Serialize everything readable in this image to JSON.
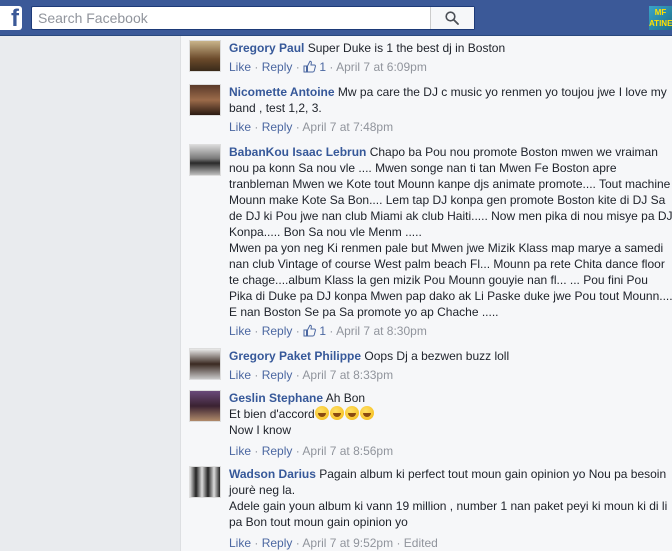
{
  "search": {
    "placeholder": "Search Facebook"
  },
  "profile_badge": "MF ATINE",
  "comments": [
    {
      "author": "Gregory Paul",
      "text": "Super Duke is 1 the best dj in Boston",
      "like": "Like",
      "reply": "Reply",
      "likes": "1",
      "time": "April 7 at 6:09pm"
    },
    {
      "author": "Nicomette Antoine",
      "text": "Mw pa care the DJ c music yo renmen yo toujou jwe I love my band , test 1,2, 3.",
      "like": "Like",
      "reply": "Reply",
      "time": "April 7 at 7:48pm"
    },
    {
      "author": "BabanKou Isaac Lebrun",
      "text": "Chapo ba Pou nou promote Boston mwen we vraiman nou pa konn Sa nou vle .... Mwen songe nan ti tan Mwen Fe Boston apre tranbleman Mwen we Kote tout Mounn kanpe djs animate promote.... Tout machine Mounn make Kote Sa Bon.... Lem tap DJ konpa gen promote Boston kite di DJ Sa de DJ ki Pou jwe nan club Miami ak club Haiti..... Now men pika di nou misye pa DJ Konpa..... Bon Sa nou vle Menm .....",
      "text2": "Mwen pa yon neg Ki renmen pale but Mwen jwe Mizik Klass map marye a samedi nan club Vintage of course West palm beach Fl... Mounn pa rete Chita dance floor te chage....album Klass la gen mizik Pou Mounn gouyie nan fl... ... Pou fini Pou Pika di Duke pa DJ konpa Mwen pap dako ak Li Paske duke jwe Pou tout Mounn.... E nan Boston Se pa Sa promote yo ap Chache .....",
      "like": "Like",
      "reply": "Reply",
      "likes": "1",
      "time": "April 7 at 8:30pm"
    },
    {
      "author": "Gregory Paket Philippe",
      "text": "Oops Dj a bezwen buzz loll",
      "like": "Like",
      "reply": "Reply",
      "time": "April 7 at 8:33pm"
    },
    {
      "author": "Geslin Stephane",
      "text": "Ah Bon",
      "text2": "Et bien d'accord",
      "text3": "Now I know",
      "like": "Like",
      "reply": "Reply",
      "time": "April 7 at 8:56pm"
    },
    {
      "author": "Wadson Darius",
      "text": "Pagain album ki perfect tout moun gain opinion yo Nou pa besoin jourè neg la.",
      "text2": "Adele gain youn album ki vann 19 million , number 1 nan paket peyi ki moun ki di li pa Bon tout moun gain opinion yo",
      "like": "Like",
      "reply": "Reply",
      "time": "April 7 at 9:52pm",
      "edited": "Edited"
    }
  ]
}
